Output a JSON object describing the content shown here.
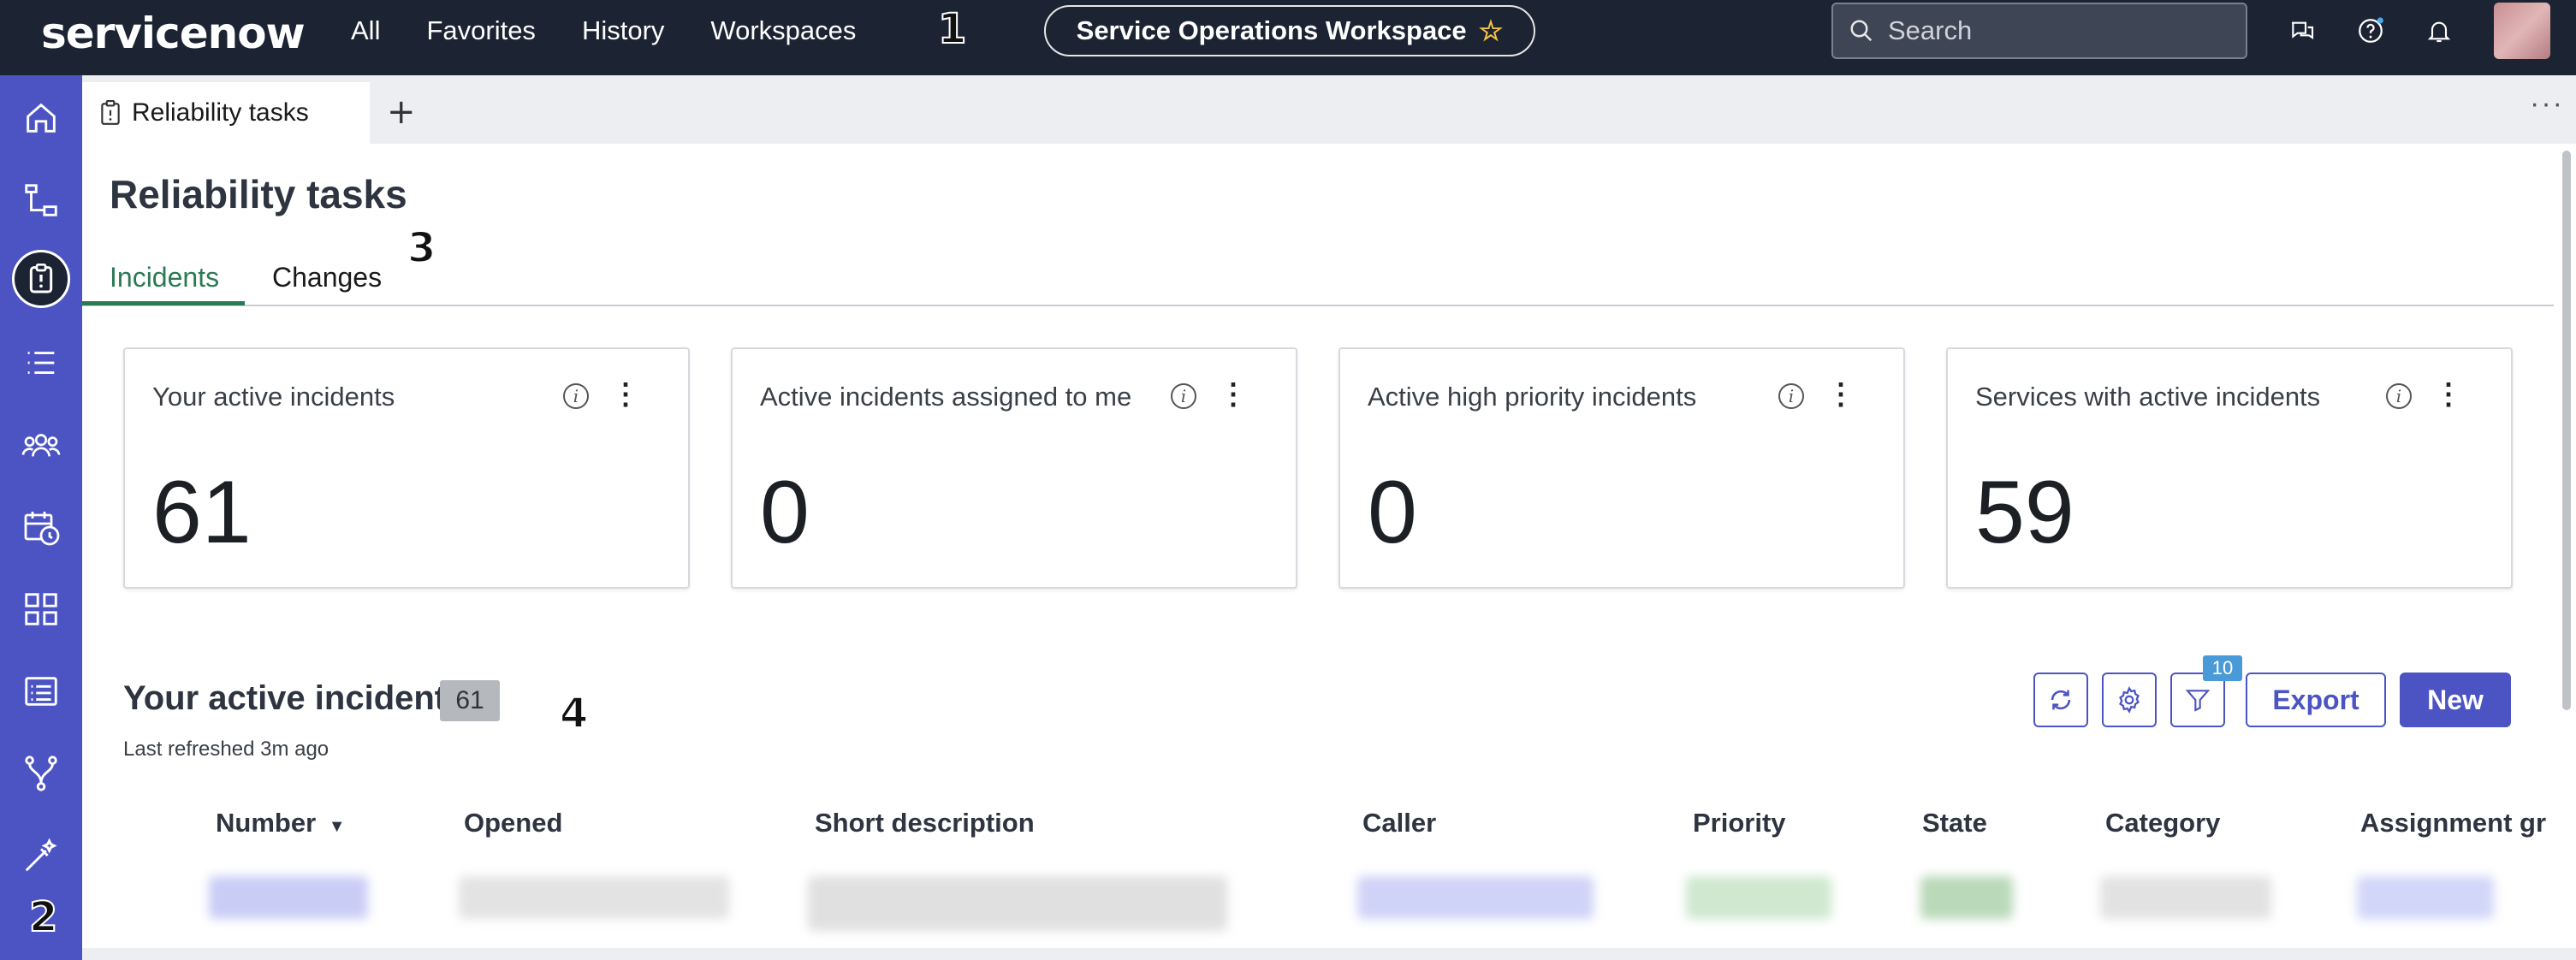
{
  "topbar": {
    "logo": "servicenow",
    "nav": [
      "All",
      "Favorites",
      "History",
      "Workspaces"
    ],
    "workspace_title": "Service Operations Workspace",
    "search_placeholder": "Search"
  },
  "annotations": [
    "1",
    "2",
    "3",
    "4"
  ],
  "tabbar": {
    "tab_label": "Reliability tasks",
    "add_tab": "+",
    "more": "···"
  },
  "page": {
    "title": "Reliability tasks",
    "subtabs": [
      "Incidents",
      "Changes"
    ],
    "active_subtab": "Incidents"
  },
  "cards": [
    {
      "title": "Your active incidents",
      "value": "61"
    },
    {
      "title": "Active incidents assigned to me",
      "value": "0"
    },
    {
      "title": "Active high priority incidents",
      "value": "0"
    },
    {
      "title": "Services with active incidents",
      "value": "59"
    }
  ],
  "list": {
    "title": "Your active incidents",
    "count": "61",
    "refreshed": "Last refreshed 3m ago",
    "filter_count": "10",
    "export_label": "Export",
    "new_label": "New",
    "columns": [
      "Number",
      "Opened",
      "Short description",
      "Caller",
      "Priority",
      "State",
      "Category",
      "Assignment gr"
    ]
  },
  "colors": {
    "topbar": "#1c2333",
    "sidebar": "#4c54c4",
    "accent": "#4c54c4",
    "active_tab": "#2b7a55"
  },
  "sidebar_icons": [
    "home-icon",
    "hierarchy-icon",
    "clipboard-icon",
    "list-icon",
    "people-icon",
    "calendar-clock-icon",
    "grid-icon",
    "list-detail-icon",
    "branch-icon",
    "magic-wand-icon"
  ]
}
